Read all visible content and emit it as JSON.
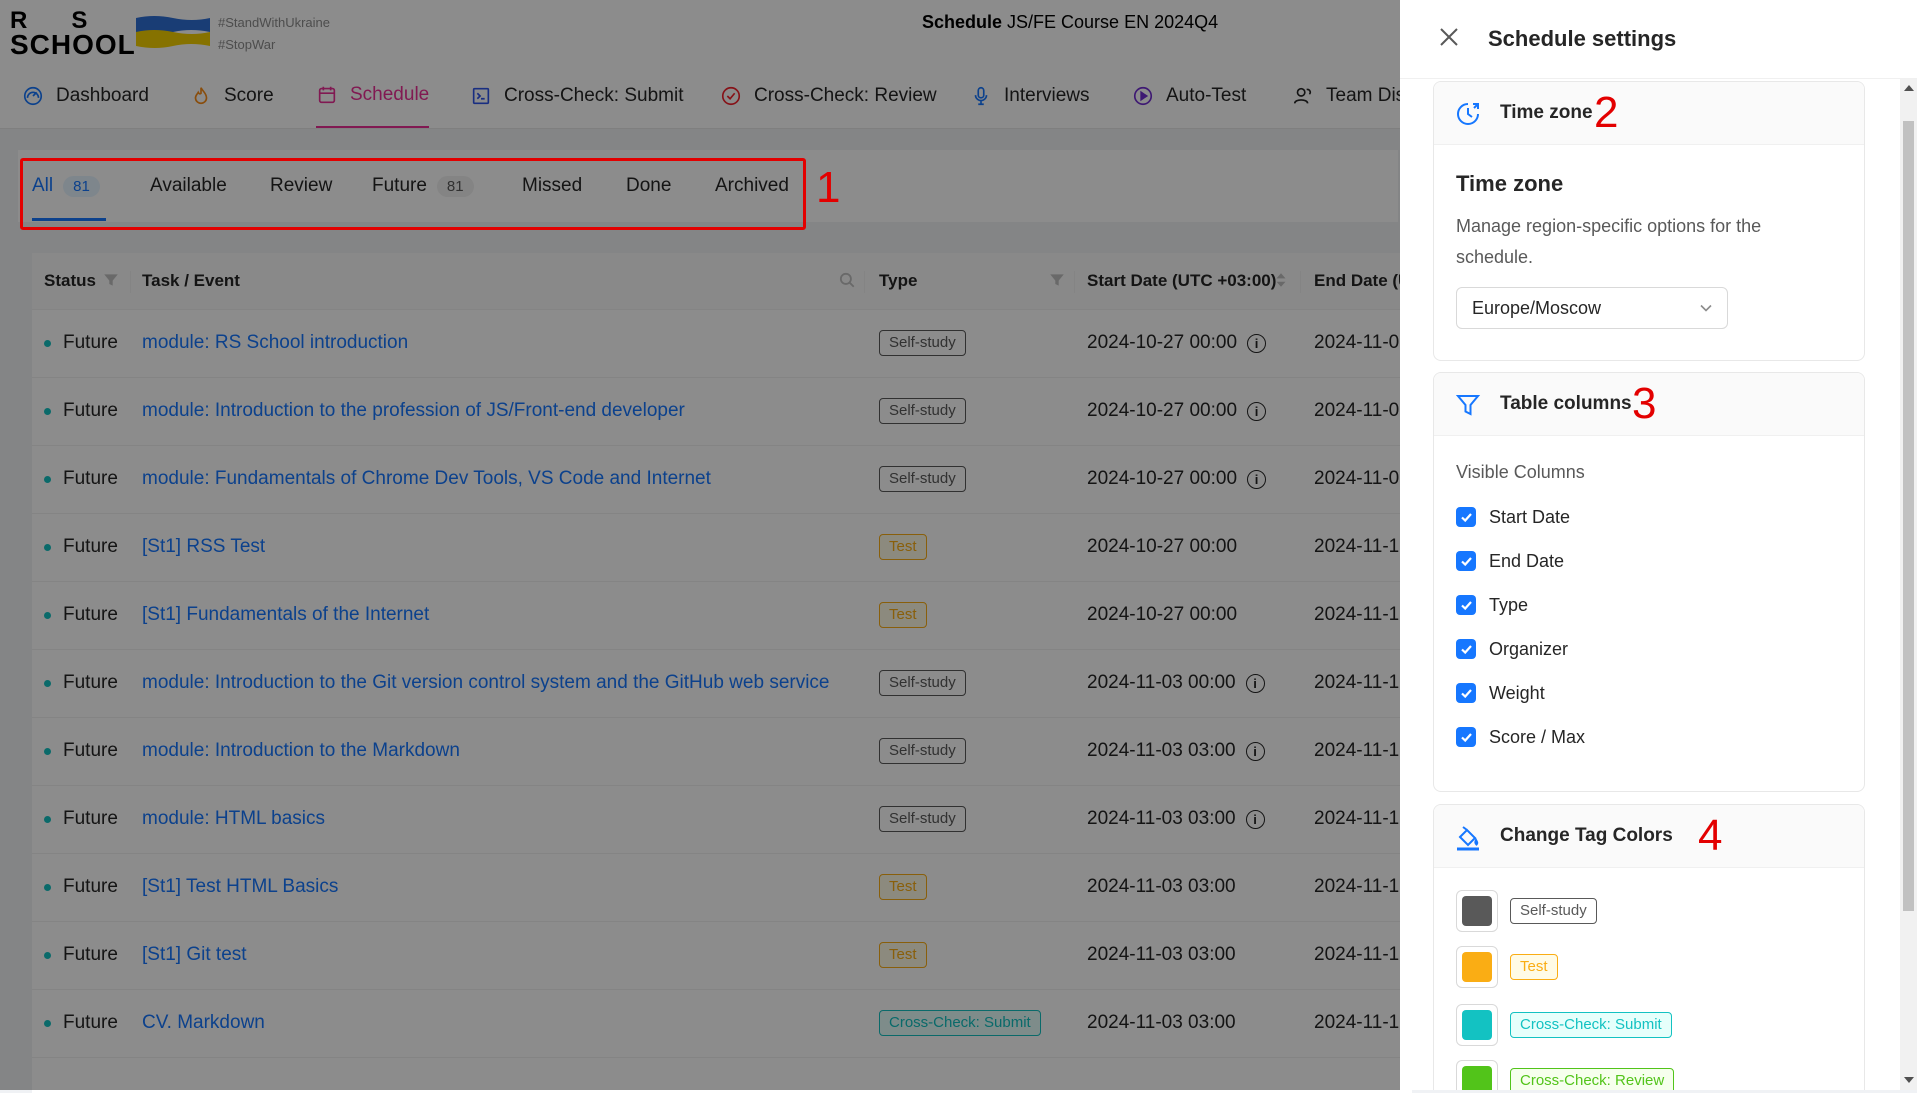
{
  "header": {
    "logo_line1": "RS",
    "logo_line2": "SCHOOL",
    "hashtag1": "#StandWithUkraine",
    "hashtag2": "#StopWar",
    "course_title_bold": "Schedule",
    "course_title_rest": " JS/FE Course EN 2024Q4"
  },
  "nav": [
    {
      "label": "Dashboard",
      "icon": "dashboard-icon"
    },
    {
      "label": "Score",
      "icon": "fire-icon"
    },
    {
      "label": "Schedule",
      "icon": "calendar-icon",
      "active": true
    },
    {
      "label": "Cross-Check: Submit",
      "icon": "code-icon"
    },
    {
      "label": "Cross-Check: Review",
      "icon": "check-circle-icon"
    },
    {
      "label": "Interviews",
      "icon": "microphone-icon"
    },
    {
      "label": "Auto-Test",
      "icon": "play-circle-icon"
    },
    {
      "label": "Team Dis",
      "icon": "team-icon"
    }
  ],
  "tabs": [
    {
      "label": "All",
      "count": "81",
      "active": true
    },
    {
      "label": "Available"
    },
    {
      "label": "Review"
    },
    {
      "label": "Future",
      "count": "81"
    },
    {
      "label": "Missed"
    },
    {
      "label": "Done"
    },
    {
      "label": "Archived"
    }
  ],
  "annotations": {
    "a1": "1",
    "a2": "2",
    "a3": "3",
    "a4": "4"
  },
  "table": {
    "headers": {
      "status": "Status",
      "task": "Task / Event",
      "type": "Type",
      "start": "Start Date (UTC +03:00)",
      "end": "End Date (U"
    },
    "rows": [
      {
        "status": "Future",
        "task": "module: RS School introduction",
        "type": "Self-study",
        "start": "2024-10-27 00:00",
        "info": true,
        "end": "2024-11-0"
      },
      {
        "status": "Future",
        "task": "module: Introduction to the profession of JS/Front-end developer",
        "type": "Self-study",
        "start": "2024-10-27 00:00",
        "info": true,
        "end": "2024-11-0"
      },
      {
        "status": "Future",
        "task": "module: Fundamentals of Chrome Dev Tools, VS Code and Internet",
        "type": "Self-study",
        "start": "2024-10-27 00:00",
        "info": true,
        "end": "2024-11-0"
      },
      {
        "status": "Future",
        "task": "[St1] RSS Test",
        "type": "Test",
        "start": "2024-10-27 00:00",
        "info": false,
        "end": "2024-11-1"
      },
      {
        "status": "Future",
        "task": "[St1] Fundamentals of the Internet",
        "type": "Test",
        "start": "2024-10-27 00:00",
        "info": false,
        "end": "2024-11-1"
      },
      {
        "status": "Future",
        "task": "module: Introduction to the Git version control system and the GitHub web service",
        "type": "Self-study",
        "start": "2024-11-03 00:00",
        "info": true,
        "end": "2024-11-1"
      },
      {
        "status": "Future",
        "task": "module: Introduction to the Markdown",
        "type": "Self-study",
        "start": "2024-11-03 03:00",
        "info": true,
        "end": "2024-11-1"
      },
      {
        "status": "Future",
        "task": "module: HTML basics",
        "type": "Self-study",
        "start": "2024-11-03 03:00",
        "info": true,
        "end": "2024-11-1"
      },
      {
        "status": "Future",
        "task": "[St1] Test HTML Basics",
        "type": "Test",
        "start": "2024-11-03 03:00",
        "info": false,
        "end": "2024-11-1"
      },
      {
        "status": "Future",
        "task": "[St1] Git test",
        "type": "Test",
        "start": "2024-11-03 03:00",
        "info": false,
        "end": "2024-11-1"
      },
      {
        "status": "Future",
        "task": "CV. Markdown",
        "type": "Cross-Check: Submit",
        "start": "2024-11-03 03:00",
        "info": false,
        "end": "2024-11-1"
      }
    ]
  },
  "tag_colors": {
    "Self-study": "#595959",
    "Test": "#faad14",
    "Cross-Check: Submit": "#13c2c2",
    "Cross-Check: Review": "#52c41a"
  },
  "drawer": {
    "title": "Schedule settings",
    "timezone": {
      "card_title": "Time zone",
      "heading": "Time zone",
      "description": "Manage region-specific options for the schedule.",
      "value": "Europe/Moscow"
    },
    "columns": {
      "card_title": "Table columns",
      "label": "Visible Columns",
      "items": [
        {
          "label": "Start Date",
          "checked": true
        },
        {
          "label": "End Date",
          "checked": true
        },
        {
          "label": "Type",
          "checked": true
        },
        {
          "label": "Organizer",
          "checked": true
        },
        {
          "label": "Weight",
          "checked": true
        },
        {
          "label": "Score / Max",
          "checked": true
        }
      ]
    },
    "tag_colors": {
      "card_title": "Change Tag Colors",
      "items": [
        {
          "label": "Self-study",
          "color": "#595959"
        },
        {
          "label": "Test",
          "color": "#faad14"
        },
        {
          "label": "Cross-Check: Submit",
          "color": "#13c2c2"
        },
        {
          "label": "Cross-Check: Review",
          "color": "#52c41a"
        }
      ]
    }
  }
}
